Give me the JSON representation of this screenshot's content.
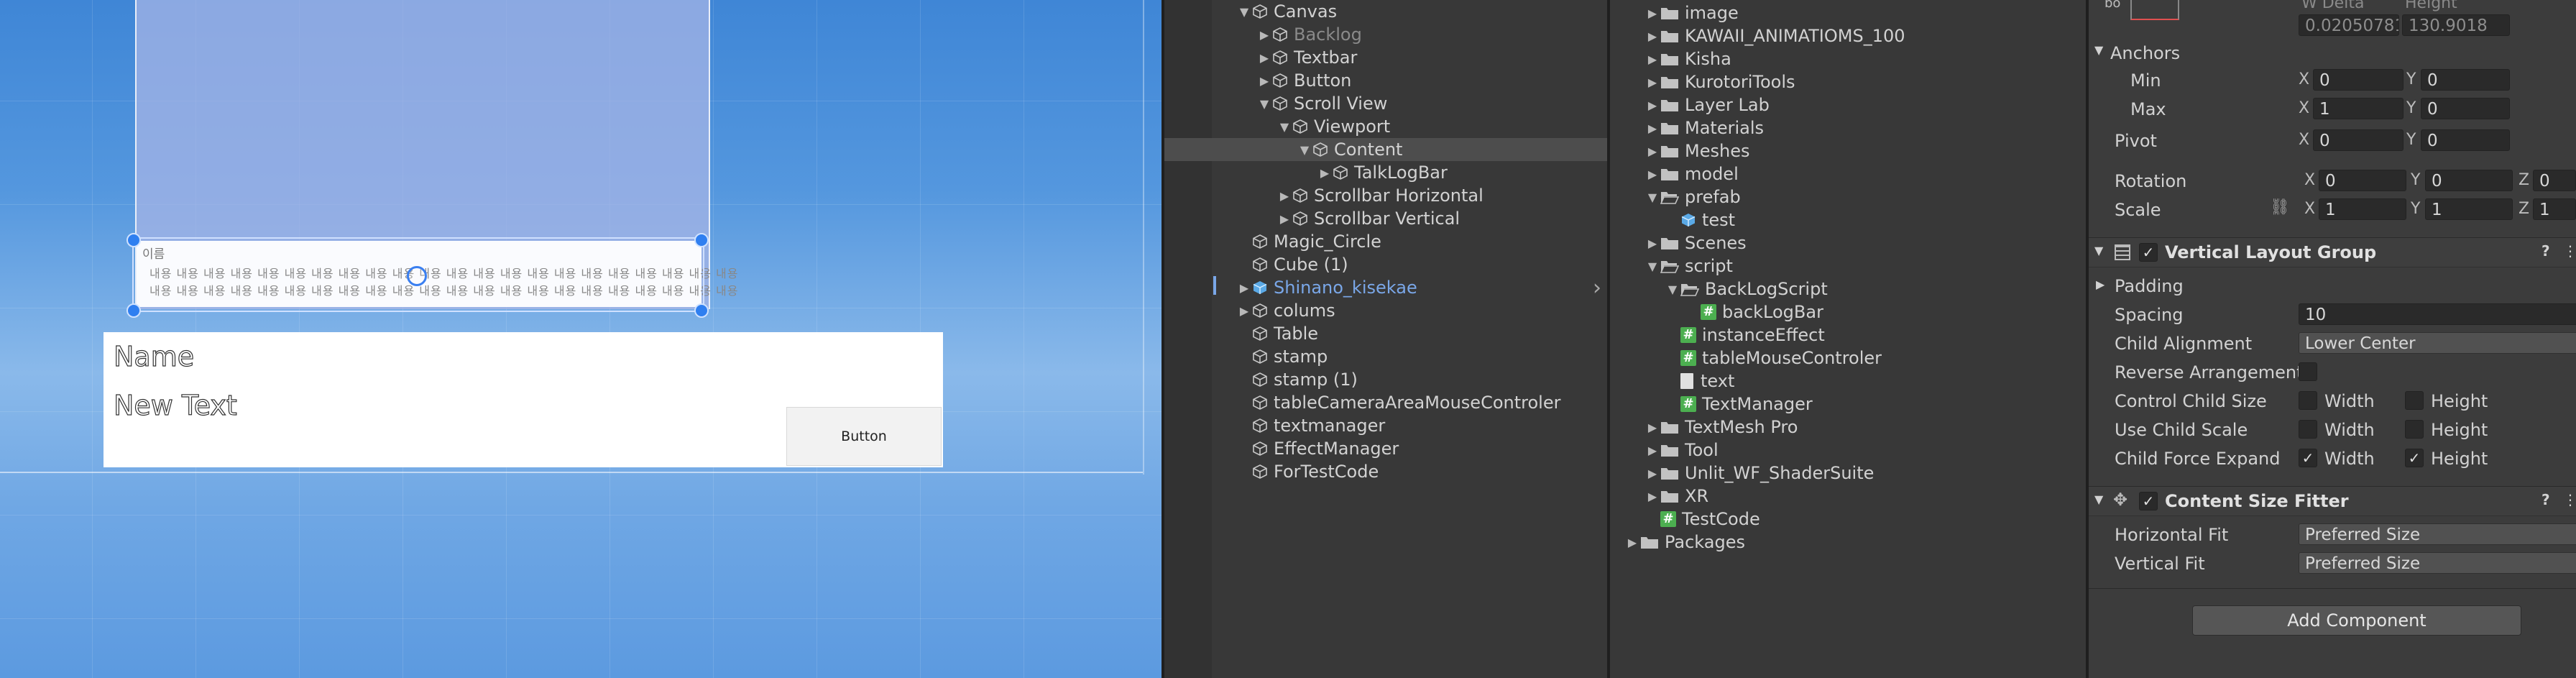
{
  "scene": {
    "log_name": "이름",
    "log_lines": [
      "내용 내용 내용 내용 내용 내용 내용 내용 내용 내용 내용 내용 내용 내용 내용 내용 내용 내용 내용 내용 내용 내용",
      "내용 내용 내용 내용 내용 내용 내용 내용 내용 내용 내용 내용 내용 내용 내용 내용 내용 내용 내용 내용 내용 내용"
    ],
    "name_text": "Name",
    "new_text": "New Text",
    "button_label": "Button"
  },
  "hierarchy": {
    "items": [
      {
        "label": "Canvas",
        "depth": 0,
        "arrow": "open",
        "icon": "cube-icon"
      },
      {
        "label": "Backlog",
        "depth": 1,
        "arrow": "closed",
        "icon": "cube-icon",
        "style": "dim"
      },
      {
        "label": "Textbar",
        "depth": 1,
        "arrow": "closed",
        "icon": "cube-icon"
      },
      {
        "label": "Button",
        "depth": 1,
        "arrow": "closed",
        "icon": "cube-icon"
      },
      {
        "label": "Scroll View",
        "depth": 1,
        "arrow": "open",
        "icon": "cube-icon"
      },
      {
        "label": "Viewport",
        "depth": 2,
        "arrow": "open",
        "icon": "cube-icon"
      },
      {
        "label": "Content",
        "depth": 3,
        "arrow": "open",
        "icon": "cube-icon",
        "selected": true
      },
      {
        "label": "TalkLogBar",
        "depth": 4,
        "arrow": "closed",
        "icon": "cube-icon"
      },
      {
        "label": "Scrollbar Horizontal",
        "depth": 2,
        "arrow": "closed",
        "icon": "cube-icon"
      },
      {
        "label": "Scrollbar Vertical",
        "depth": 2,
        "arrow": "closed",
        "icon": "cube-icon"
      },
      {
        "label": "Magic_Circle",
        "depth": 0,
        "arrow": "none",
        "icon": "cube-icon"
      },
      {
        "label": "Cube (1)",
        "depth": 0,
        "arrow": "none",
        "icon": "cube-icon"
      },
      {
        "label": "Shinano_kisekae",
        "depth": 0,
        "arrow": "closed",
        "icon": "prefab-icon",
        "style": "blue"
      },
      {
        "label": "colums",
        "depth": 0,
        "arrow": "closed",
        "icon": "cube-icon"
      },
      {
        "label": "Table",
        "depth": 0,
        "arrow": "none",
        "icon": "cube-icon"
      },
      {
        "label": "stamp",
        "depth": 0,
        "arrow": "none",
        "icon": "cube-icon"
      },
      {
        "label": "stamp (1)",
        "depth": 0,
        "arrow": "none",
        "icon": "cube-icon"
      },
      {
        "label": "tableCameraAreaMouseControler",
        "depth": 0,
        "arrow": "none",
        "icon": "cube-icon"
      },
      {
        "label": "textmanager",
        "depth": 0,
        "arrow": "none",
        "icon": "cube-icon"
      },
      {
        "label": "EffectManager",
        "depth": 0,
        "arrow": "none",
        "icon": "cube-icon"
      },
      {
        "label": "ForTestCode",
        "depth": 0,
        "arrow": "none",
        "icon": "cube-icon"
      }
    ]
  },
  "project": {
    "items": [
      {
        "label": "image",
        "depth": 1,
        "arrow": "closed",
        "icon": "folder-icon"
      },
      {
        "label": "KAWAII_ANIMATIOMS_100",
        "depth": 1,
        "arrow": "closed",
        "icon": "folder-icon"
      },
      {
        "label": "Kisha",
        "depth": 1,
        "arrow": "closed",
        "icon": "folder-icon"
      },
      {
        "label": "KurotoriTools",
        "depth": 1,
        "arrow": "closed",
        "icon": "folder-icon"
      },
      {
        "label": "Layer Lab",
        "depth": 1,
        "arrow": "closed",
        "icon": "folder-icon"
      },
      {
        "label": "Materials",
        "depth": 1,
        "arrow": "closed",
        "icon": "folder-icon"
      },
      {
        "label": "Meshes",
        "depth": 1,
        "arrow": "closed",
        "icon": "folder-icon"
      },
      {
        "label": "model",
        "depth": 1,
        "arrow": "closed",
        "icon": "folder-icon"
      },
      {
        "label": "prefab",
        "depth": 1,
        "arrow": "open",
        "icon": "folder-open-icon"
      },
      {
        "label": "test",
        "depth": 2,
        "arrow": "none",
        "icon": "prefab-icon"
      },
      {
        "label": "Scenes",
        "depth": 1,
        "arrow": "closed",
        "icon": "folder-icon"
      },
      {
        "label": "script",
        "depth": 1,
        "arrow": "open",
        "icon": "folder-open-icon"
      },
      {
        "label": "BackLogScript",
        "depth": 2,
        "arrow": "open",
        "icon": "folder-open-icon"
      },
      {
        "label": "backLogBar",
        "depth": 3,
        "arrow": "none",
        "icon": "csharp-icon"
      },
      {
        "label": "instanceEffect",
        "depth": 2,
        "arrow": "none",
        "icon": "csharp-icon"
      },
      {
        "label": "tableMouseControler",
        "depth": 2,
        "arrow": "none",
        "icon": "csharp-icon"
      },
      {
        "label": "text",
        "depth": 2,
        "arrow": "none",
        "icon": "text-file-icon"
      },
      {
        "label": "TextManager",
        "depth": 2,
        "arrow": "none",
        "icon": "csharp-icon"
      },
      {
        "label": "TextMesh Pro",
        "depth": 1,
        "arrow": "closed",
        "icon": "folder-icon"
      },
      {
        "label": "Tool",
        "depth": 1,
        "arrow": "closed",
        "icon": "folder-icon"
      },
      {
        "label": "Unlit_WF_ShaderSuite",
        "depth": 1,
        "arrow": "closed",
        "icon": "folder-icon"
      },
      {
        "label": "XR",
        "depth": 1,
        "arrow": "closed",
        "icon": "folder-icon"
      },
      {
        "label": "TestCode",
        "depth": 1,
        "arrow": "none",
        "icon": "csharp-icon"
      },
      {
        "label": "Packages",
        "depth": 0,
        "arrow": "closed",
        "icon": "folder-icon"
      }
    ]
  },
  "inspector": {
    "top_cut_label": "bo",
    "w_delta_label": "W Delta",
    "height_label": "Height",
    "w_delta_value": "0.02050781",
    "height_value": "130.9018",
    "anchors_label": "Anchors",
    "min_label": "Min",
    "max_label": "Max",
    "pivot_label": "Pivot",
    "rotation_label": "Rotation",
    "scale_label": "Scale",
    "x": "X",
    "y": "Y",
    "z": "Z",
    "min_x": "0",
    "min_y": "0",
    "max_x": "1",
    "max_y": "0",
    "pivot_x": "0",
    "pivot_y": "0",
    "rot_x": "0",
    "rot_y": "0",
    "rot_z": "0",
    "scale_x": "1",
    "scale_y": "1",
    "scale_z": "1",
    "vlg_title": "Vertical Layout Group",
    "padding_label": "Padding",
    "spacing_label": "Spacing",
    "spacing_value": "10",
    "child_alignment_label": "Child Alignment",
    "child_alignment_value": "Lower Center",
    "reverse_label": "Reverse Arrangement",
    "ccs_label": "Control Child Size",
    "ucs_label": "Use Child Scale",
    "cfe_label": "Child Force Expand",
    "width_label": "Width",
    "height_opt_label": "Height",
    "csf_title": "Content Size Fitter",
    "hfit_label": "Horizontal Fit",
    "hfit_value": "Preferred Size",
    "vfit_label": "Vertical Fit",
    "vfit_value": "Preferred Size",
    "add_component": "Add Component",
    "help": "?",
    "menu": "⋮",
    "checkmark": "✓"
  }
}
